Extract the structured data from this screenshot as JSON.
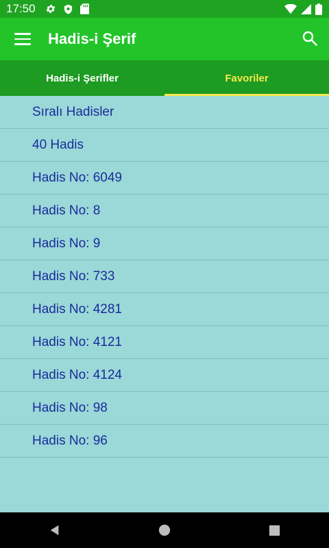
{
  "status_bar": {
    "time": "17:50",
    "left_icons": [
      "settings-gear-icon",
      "shield-icon",
      "sd-card-icon"
    ],
    "right_icons": [
      "wifi-icon",
      "signal-icon",
      "battery-icon"
    ]
  },
  "app_bar": {
    "title": "Hadis-i Şerif",
    "menu_icon": "hamburger-menu-icon",
    "search_icon": "search-icon",
    "color": "#22c42a"
  },
  "tabs": [
    {
      "label": "Hadis-i Şerifler",
      "active": false
    },
    {
      "label": "Favoriler",
      "active": true
    }
  ],
  "list": {
    "items": [
      "Sıralı Hadisler",
      "40 Hadis",
      "Hadis No: 6049",
      "Hadis No: 8",
      "Hadis No: 9",
      "Hadis No: 733",
      "Hadis No: 4281",
      "Hadis No: 4121",
      "Hadis No: 4124",
      "Hadis No: 98",
      "Hadis No: 96"
    ]
  },
  "nav_bar": {
    "buttons": [
      "back-icon",
      "home-icon",
      "recents-icon"
    ]
  },
  "colors": {
    "accent": "#f7e94a",
    "list_background": "#9bd8d8",
    "list_text": "#1a2c9a"
  }
}
